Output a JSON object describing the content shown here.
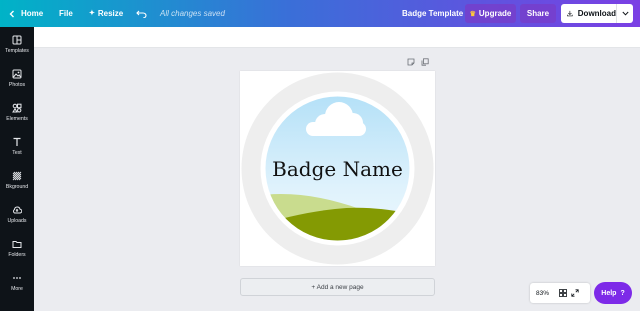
{
  "topbar": {
    "home_label": "Home",
    "file_label": "File",
    "resize_label": "Resize",
    "saved_status": "All changes saved",
    "document_title": "Badge Template",
    "upgrade_label": "Upgrade",
    "share_label": "Share",
    "download_label": "Download"
  },
  "sidebar": {
    "items": [
      {
        "label": "Templates",
        "icon": "templates-icon"
      },
      {
        "label": "Photos",
        "icon": "photos-icon"
      },
      {
        "label": "Elements",
        "icon": "elements-icon"
      },
      {
        "label": "Text",
        "icon": "text-icon"
      },
      {
        "label": "Bkground",
        "icon": "background-icon"
      },
      {
        "label": "Uploads",
        "icon": "uploads-icon"
      },
      {
        "label": "Folders",
        "icon": "folders-icon"
      },
      {
        "label": "More",
        "icon": "more-icon"
      }
    ]
  },
  "canvas": {
    "badge_text": "Badge Name",
    "add_page_label": "+ Add a new page"
  },
  "footer": {
    "zoom": "83%",
    "help_label": "Help",
    "help_symbol": "?"
  },
  "colors": {
    "brand_purple": "#7d2ae8",
    "sidebar_bg": "#0e1318",
    "ring_gray": "#eeeeee",
    "sky_blue": "#bfe3f8",
    "grass_dark": "#8a9a05",
    "grass_light": "#c5d98a"
  }
}
